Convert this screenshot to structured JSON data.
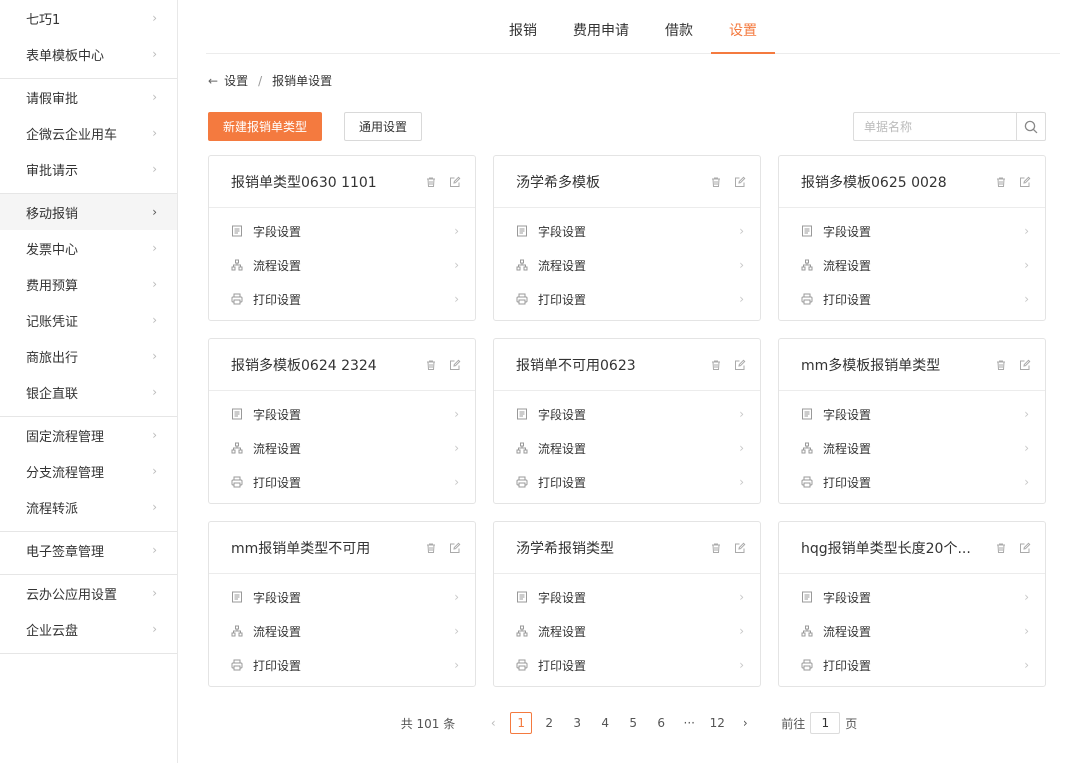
{
  "sidebar": {
    "groups": [
      [
        "七巧1",
        "表单模板中心"
      ],
      [
        "请假审批",
        "企微云企业用车",
        "审批请示"
      ],
      [
        "移动报销",
        "发票中心",
        "费用预算",
        "记账凭证",
        "商旅出行",
        "银企直联"
      ],
      [
        "固定流程管理",
        "分支流程管理",
        "流程转派"
      ],
      [
        "电子签章管理"
      ],
      [
        "云办公应用设置",
        "企业云盘"
      ]
    ],
    "active": "移动报销"
  },
  "tabs": [
    "报销",
    "费用申请",
    "借款",
    "设置"
  ],
  "active_tab": "设置",
  "breadcrumb": {
    "root": "设置",
    "current": "报销单设置"
  },
  "toolbar": {
    "new_button": "新建报销单类型",
    "general_button": "通用设置",
    "search_placeholder": "单据名称"
  },
  "setting_labels": [
    "字段设置",
    "流程设置",
    "打印设置"
  ],
  "cards": [
    "报销单类型0630 1101",
    "汤学希多模板",
    "报销多模板0625 0028",
    "报销多模板0624 2324",
    "报销单不可用0623",
    "mm多模板报销单类型",
    "mm报销单类型不可用",
    "汤学希报销类型",
    "hqg报销单类型长度20个..."
  ],
  "pagination": {
    "total": "共 101 条",
    "pages": [
      "1",
      "2",
      "3",
      "4",
      "5",
      "6",
      "···",
      "12"
    ],
    "current": "1",
    "goto_label": "前往",
    "goto_value": "1",
    "page_suffix": "页"
  },
  "colors": {
    "accent": "#f47a3f"
  }
}
